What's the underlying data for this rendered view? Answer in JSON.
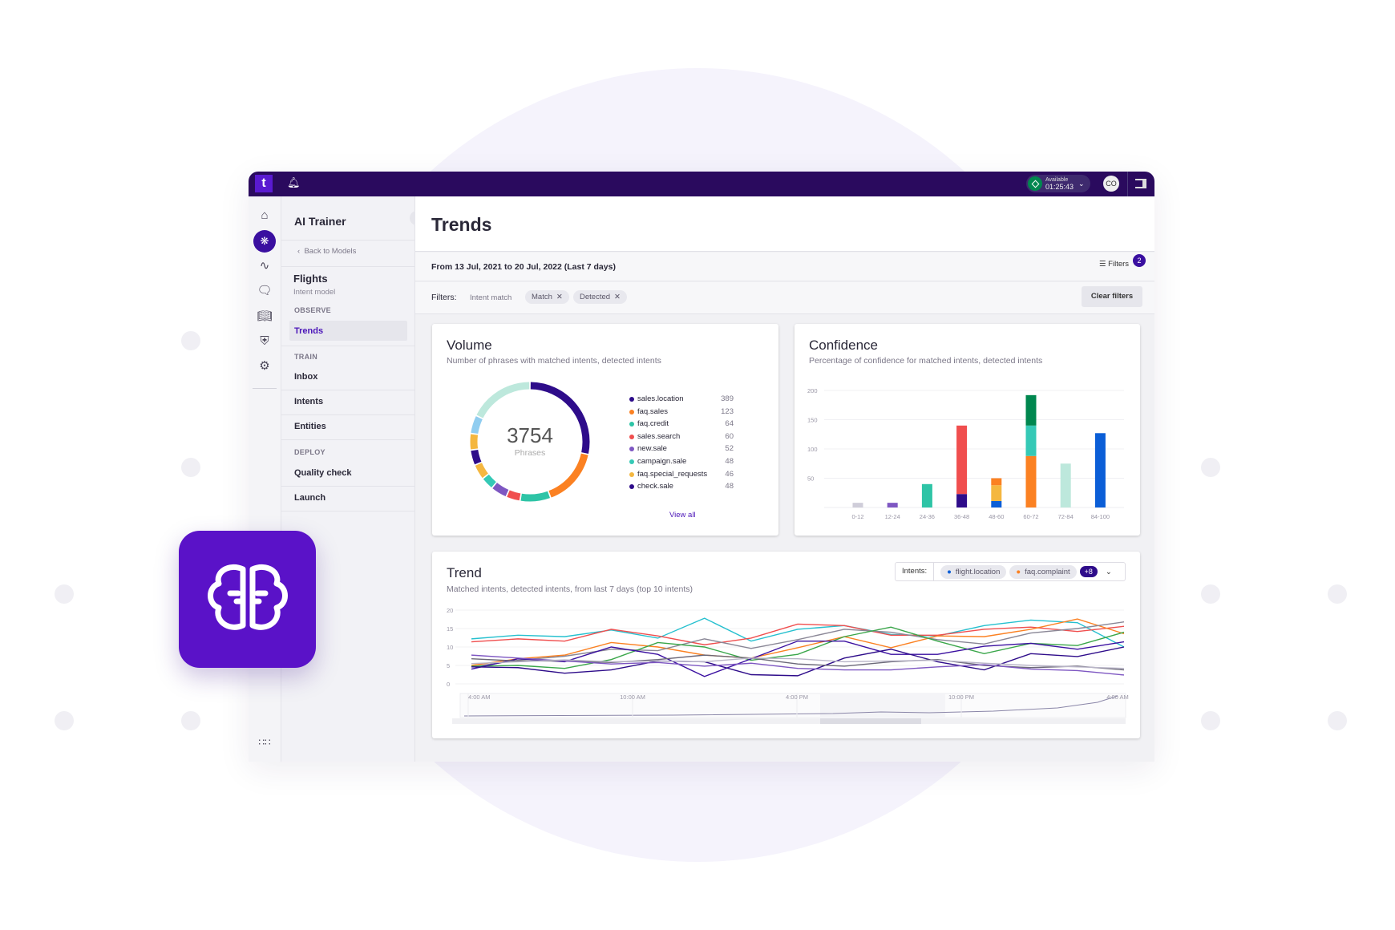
{
  "topbar": {
    "logo": "t",
    "status_label": "Available",
    "status_time": "01:25:43",
    "avatar": "CO",
    "icons": [
      "bell-icon",
      "chevron-down-icon",
      "panel-icon"
    ]
  },
  "rail": {
    "icons": [
      "home-icon",
      "brain-icon",
      "waveform-icon",
      "chat-icon",
      "book-icon",
      "shield-icon",
      "gear-icon",
      "apps-grid-icon"
    ]
  },
  "nav": {
    "title": "AI Trainer",
    "back": "Back to Models",
    "model_name": "Flights",
    "model_type": "Intent model",
    "sections": [
      {
        "label": "OBSERVE",
        "items": [
          "Trends"
        ]
      },
      {
        "label": "TRAIN",
        "items": [
          "Inbox",
          "Intents",
          "Entities"
        ]
      },
      {
        "label": "DEPLOY",
        "items": [
          "Quality check",
          "Launch"
        ]
      }
    ],
    "active": "Trends"
  },
  "main": {
    "title": "Trends",
    "date_range": "From 13 Jul, 2021 to 20 Jul, 2022 (Last 7 days)",
    "filter_button": "Filters",
    "filter_count": "2",
    "filters_label": "Filters:",
    "filter_group": "Intent match",
    "filter_chips": [
      "Match",
      "Detected"
    ],
    "clear_filters": "Clear filters"
  },
  "volume": {
    "title": "Volume",
    "subtitle": "Number of phrases with matched intents, detected intents",
    "total": "3754",
    "total_label": "Phrases",
    "view_all": "View all",
    "legend": [
      {
        "name": "sales.location",
        "value": "389",
        "color": "#2e0c8a"
      },
      {
        "name": "faq.sales",
        "value": "123",
        "color": "#fb8122"
      },
      {
        "name": "faq.credit",
        "value": "64",
        "color": "#2ec4a6"
      },
      {
        "name": "sales.search",
        "value": "60",
        "color": "#f04e4e"
      },
      {
        "name": "new.sale",
        "value": "52",
        "color": "#7e57c2"
      },
      {
        "name": "campaign.sale",
        "value": "48",
        "color": "#35c9b6"
      },
      {
        "name": "faq.special_requests",
        "value": "46",
        "color": "#f4b740"
      },
      {
        "name": "check.sale",
        "value": "48",
        "color": "#2e0c8a"
      }
    ]
  },
  "confidence": {
    "title": "Confidence",
    "subtitle": "Percentage of confidence for matched intents, detected intents"
  },
  "trend": {
    "title": "Trend",
    "subtitle": "Matched intents, detected intents, from last 7 days (top 10 intents)",
    "intents_label": "Intents:",
    "intent_chips": [
      {
        "name": "flight.location",
        "color": "#0b5ed7"
      },
      {
        "name": "faq.complaint",
        "color": "#fb8122"
      }
    ],
    "more": "+8"
  },
  "chart_data": [
    {
      "type": "pie",
      "name": "volume-donut",
      "total": 3754,
      "slices_percent": [
        {
          "label": "sales.location",
          "share": 26.7,
          "color": "#2e0c8a"
        },
        {
          "label": "faq.sales",
          "share": 15,
          "color": "#fb8122"
        },
        {
          "label": "faq.credit",
          "share": 7.8,
          "color": "#2ec4a6"
        },
        {
          "label": "sales.search",
          "share": 3.6,
          "color": "#f04e4e"
        },
        {
          "label": "new.sale",
          "share": 4.2,
          "color": "#7e57c2"
        },
        {
          "label": "campaign.sale",
          "share": 3.3,
          "color": "#35c9b6"
        },
        {
          "label": "faq.special_requests",
          "share": 3.9,
          "color": "#f4b740"
        },
        {
          "label": "check.sale",
          "share": 3.9,
          "color": "#2e0c8a"
        },
        {
          "label": "",
          "share": 4.2,
          "color": "#f4b740"
        },
        {
          "label": "",
          "share": 4.7,
          "color": "#90cdf0"
        },
        {
          "label": "",
          "share": 16.7,
          "color": "#bde8dc"
        }
      ]
    },
    {
      "type": "bar",
      "stacked": true,
      "name": "confidence-bars",
      "categories": [
        "0-12",
        "12-24",
        "24-36",
        "36-48",
        "48-60",
        "60-72",
        "72-84",
        "84-100"
      ],
      "ylim": [
        0,
        200
      ],
      "yticks": [
        50,
        100,
        150,
        200
      ],
      "grid": true,
      "stacks": [
        [
          {
            "v": 8,
            "c": "#cfcdd9"
          }
        ],
        [
          {
            "v": 8,
            "c": "#7e57c2"
          }
        ],
        [
          {
            "v": 40,
            "c": "#2ec4a6"
          }
        ],
        [
          {
            "v": 23,
            "c": "#2e0c8a"
          },
          {
            "v": 117,
            "c": "#f04e4e"
          }
        ],
        [
          {
            "v": 11,
            "c": "#0b5ed7"
          },
          {
            "v": 27,
            "c": "#f4b740"
          },
          {
            "v": 12,
            "c": "#fb8122"
          }
        ],
        [
          {
            "v": 88,
            "c": "#fb8122"
          },
          {
            "v": 52,
            "c": "#35c9b6"
          },
          {
            "v": 52,
            "c": "#00874f"
          }
        ],
        [
          {
            "v": 75,
            "c": "#bde8dc"
          }
        ],
        [
          {
            "v": 127,
            "c": "#0b5ed7"
          }
        ]
      ]
    },
    {
      "type": "line",
      "name": "trend-lines",
      "ylim": [
        0,
        20
      ],
      "yticks": [
        0,
        5,
        10,
        15,
        20
      ],
      "xticks": [
        "4:00 AM",
        "10:00 AM",
        "4:00 PM",
        "10:00 PM",
        "4:00 AM"
      ],
      "grid": true,
      "series": [
        {
          "color": "#26c0cf",
          "values": [
            12.2,
            13.2,
            12.8,
            14.6,
            12.4,
            17.8,
            11.6,
            14.8,
            15.8,
            13.4,
            13,
            15.8,
            17.3,
            16.6,
            10
          ]
        },
        {
          "color": "#f04e4e",
          "values": [
            11.4,
            12.2,
            11.6,
            14.8,
            13,
            10.6,
            12.4,
            16.2,
            15.8,
            13.2,
            13.2,
            14.8,
            15.4,
            14.2,
            15.6
          ]
        },
        {
          "color": "#fb8122",
          "values": [
            5,
            6.8,
            7.8,
            11.2,
            10,
            7.8,
            7,
            9.8,
            12.8,
            9.8,
            13,
            12.8,
            14.8,
            17.6,
            13.6
          ]
        },
        {
          "color": "#8a8796",
          "values": [
            4.6,
            6.4,
            7.5,
            9.4,
            9,
            12.2,
            9.6,
            12,
            14.8,
            14,
            12,
            10.8,
            13.8,
            15,
            16.8
          ]
        },
        {
          "color": "#3aa64a",
          "values": [
            4.8,
            5,
            4.2,
            6.6,
            11.2,
            10,
            6.4,
            8,
            12.8,
            15.4,
            11.6,
            8.2,
            11,
            10.4,
            14
          ]
        },
        {
          "color": "#3a0fa0",
          "values": [
            4,
            6.8,
            6,
            10,
            8,
            2,
            6.8,
            11.6,
            11.6,
            8,
            8,
            10.2,
            11,
            9.4,
            11.4
          ]
        },
        {
          "color": "#2e0c8a",
          "values": [
            4.6,
            4.4,
            2.9,
            3.8,
            6.2,
            6,
            2.5,
            2.2,
            7,
            9.4,
            6,
            3.8,
            8.2,
            7.4,
            10
          ]
        },
        {
          "color": "#6b6878",
          "values": [
            6.8,
            6.2,
            6.2,
            5.8,
            6.6,
            7.8,
            7,
            5.4,
            4.8,
            6,
            6.6,
            5,
            4.4,
            4.8,
            3.8
          ]
        },
        {
          "color": "#7e57c2",
          "values": [
            7.8,
            7,
            6.2,
            5.4,
            5.8,
            4.8,
            5.6,
            4.2,
            3.8,
            3.8,
            4.6,
            5.2,
            4,
            3.6,
            2.4
          ]
        },
        {
          "color": "#b9b5c8",
          "values": [
            5.5,
            6,
            6.5,
            6,
            6.2,
            6,
            7,
            6.8,
            6,
            6.2,
            6.4,
            5.6,
            5,
            4.6,
            4.2
          ]
        }
      ]
    }
  ]
}
